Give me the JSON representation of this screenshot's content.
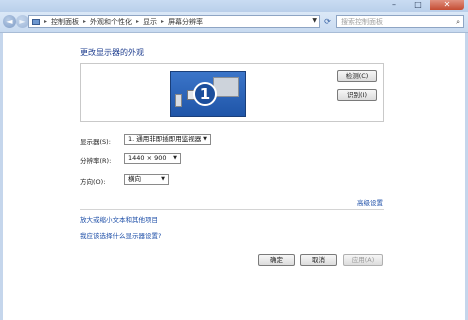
{
  "window": {
    "min": "–",
    "max": "□",
    "close": "✕"
  },
  "address": {
    "crumbs": [
      "控制面板",
      "外观和个性化",
      "显示",
      "屏幕分辨率"
    ],
    "search_placeholder": "搜索控制面板"
  },
  "page": {
    "title": "更改显示器的外观"
  },
  "preview": {
    "monitor_number": "1"
  },
  "buttons": {
    "detect": "检测(C)",
    "identify": "识别(I)",
    "ok": "确定",
    "cancel": "取消",
    "apply": "应用(A)"
  },
  "fields": {
    "display": {
      "label": "显示器(S):",
      "value": "1. 通用非即插即用监视器"
    },
    "resolution": {
      "label": "分辨率(R):",
      "value": "1440 × 900"
    },
    "orientation": {
      "label": "方向(O):",
      "value": "横向"
    }
  },
  "links": {
    "advanced": "高级设置",
    "text_size": "放大或缩小文本和其他项目",
    "help": "我应该选择什么显示器设置?"
  }
}
